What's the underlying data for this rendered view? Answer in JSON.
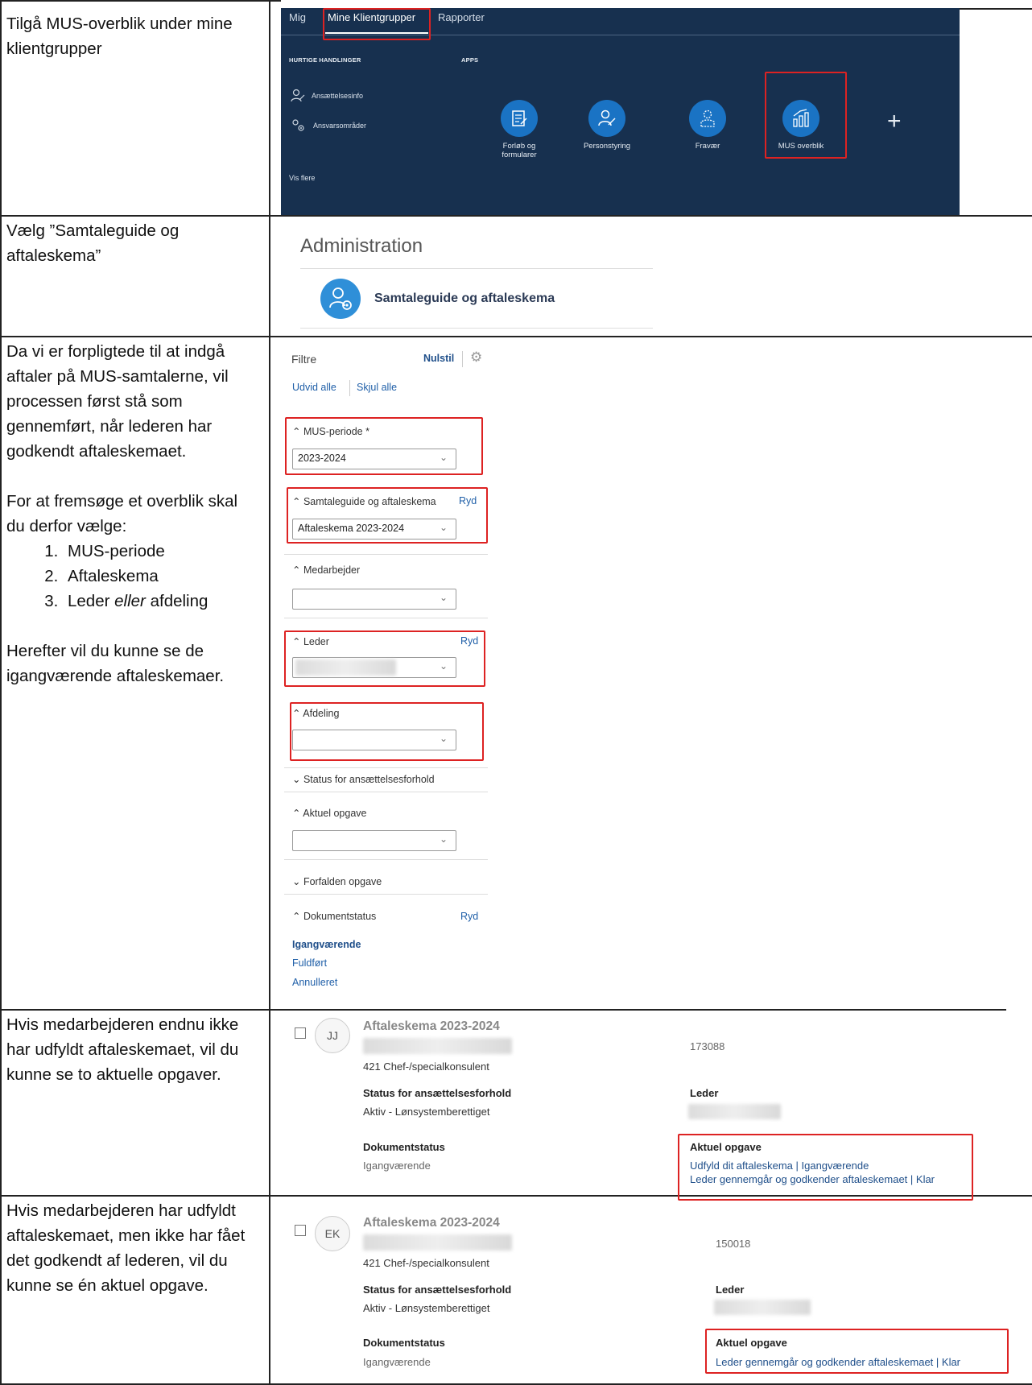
{
  "rows": [
    {
      "text": "Tilgå MUS-overblik under mine klientgrupper"
    },
    {
      "text": "Vælg ”Samtaleguide og aftaleskema”"
    },
    {
      "text_p1": "Da vi er forpligtede til at indgå aftaler på MUS-samtalerne, vil processen først stå som gennemført, når lederen har godkendt aftaleskemaet.",
      "text_p2": "For at fremsøge et overblik skal du derfor vælge:",
      "list": [
        "MUS-periode",
        "Aftaleskema",
        "Leder"
      ],
      "list3_italic": "eller",
      "list3_rest": "afdeling",
      "text_p3": "Herefter vil du kunne se de igangværende aftaleskemaer."
    },
    {
      "text": "Hvis medarbejderen endnu ikke har udfyldt aftaleskemaet, vil du kunne se to aktuelle opgaver."
    },
    {
      "text": "Hvis medarbejderen har udfyldt aftaleskemaet, men ikke har fået det godkendt af lederen, vil du kunne se én aktuel opgave."
    }
  ],
  "app_panel": {
    "tabs": [
      "Mig",
      "Mine Klientgrupper",
      "Rapporter"
    ],
    "quick_actions_heading": "HURTIGE HANDLINGER",
    "apps_heading": "APPS",
    "quick_actions": [
      "Ansættelsesinfo",
      "Ansvarsområder"
    ],
    "show_more": "Vis flere",
    "apps": [
      {
        "label": "Forløb og formularer",
        "icon": "form-icon"
      },
      {
        "label": "Personstyring",
        "icon": "person-edit-icon"
      },
      {
        "label": "Fravær",
        "icon": "person-outline-icon"
      },
      {
        "label": "MUS overblik",
        "icon": "bar-chart-icon"
      }
    ],
    "add": "+"
  },
  "admin": {
    "title": "Administration",
    "item": "Samtaleguide og aftaleskema"
  },
  "filters": {
    "title": "Filtre",
    "reset": "Nulstil",
    "expand_all": "Udvid alle",
    "hide_all": "Skjul alle",
    "mus_period_label": "MUS-periode *",
    "mus_period_value": "2023-2024",
    "guide_label": "Samtaleguide og aftaleskema",
    "guide_value": "Aftaleskema 2023-2024",
    "clear": "Ryd",
    "employee_label": "Medarbejder",
    "leader_label": "Leder",
    "department_label": "Afdeling",
    "employment_status_label": "Status for ansættelsesforhold",
    "current_task_label": "Aktuel opgave",
    "overdue_task_label": "Forfalden opgave",
    "doc_status_label": "Dokumentstatus",
    "doc_status_options": [
      "Igangværende",
      "Fuldført",
      "Annulleret"
    ]
  },
  "cards": [
    {
      "initials": "JJ",
      "title": "Aftaleskema 2023-2024",
      "position": "421 Chef-/specialkonsulent",
      "number": "173088",
      "status_label": "Status for ansættelsesforhold",
      "status_value": "Aktiv - Lønsystemberettiget",
      "leader_label": "Leder",
      "doc_label": "Dokumentstatus",
      "doc_value": "Igangværende",
      "task_label": "Aktuel opgave",
      "tasks": [
        "Udfyld dit aftaleskema | Igangværende",
        "Leder gennemgår og godkender aftaleskemaet | Klar"
      ]
    },
    {
      "initials": "EK",
      "title": "Aftaleskema 2023-2024",
      "position": "421 Chef-/specialkonsulent",
      "number": "150018",
      "status_label": "Status for ansættelsesforhold",
      "status_value": "Aktiv - Lønsystemberettiget",
      "leader_label": "Leder",
      "doc_label": "Dokumentstatus",
      "doc_value": "Igangværende",
      "task_label": "Aktuel opgave",
      "tasks": [
        "Leder gennemgår og godkender aftaleskemaet | Klar"
      ]
    }
  ]
}
